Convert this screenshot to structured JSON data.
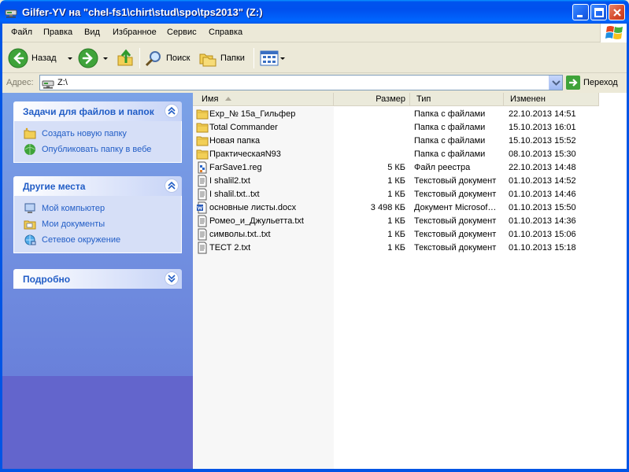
{
  "window": {
    "title": "Gilfer-YV  на \"chel-fs1\\chirt\\stud\\spo\\tps2013\" (Z:)"
  },
  "menu": [
    "Файл",
    "Правка",
    "Вид",
    "Избранное",
    "Сервис",
    "Справка"
  ],
  "toolbar": {
    "back_label": "Назад",
    "search_label": "Поиск",
    "folders_label": "Папки"
  },
  "address": {
    "label": "Адрес:",
    "value": "Z:\\",
    "go_label": "Переход"
  },
  "tasks_panel": {
    "title": "Задачи для файлов и папок",
    "items": [
      {
        "label": "Создать новую папку",
        "icon": "new-folder-icon"
      },
      {
        "label": "Опубликовать папку в вебе",
        "icon": "publish-web-icon"
      }
    ]
  },
  "places_panel": {
    "title": "Другие места",
    "items": [
      {
        "label": "Мой компьютер",
        "icon": "my-computer-icon"
      },
      {
        "label": "Мои документы",
        "icon": "my-documents-icon"
      },
      {
        "label": "Сетевое окружение",
        "icon": "network-icon"
      }
    ]
  },
  "details_panel": {
    "title": "Подробно"
  },
  "columns": {
    "name": "Имя",
    "size": "Размер",
    "type": "Тип",
    "modified": "Изменен"
  },
  "files": [
    {
      "name": "Exp_№ 15a_Гильфер",
      "size": "",
      "type": "Папка с файлами",
      "modified": "22.10.2013 14:51",
      "icon": "folder-icon"
    },
    {
      "name": "Total Commander",
      "size": "",
      "type": "Папка с файлами",
      "modified": "15.10.2013 16:01",
      "icon": "folder-icon"
    },
    {
      "name": "Новая папка",
      "size": "",
      "type": "Папка с файлами",
      "modified": "15.10.2013 15:52",
      "icon": "folder-icon"
    },
    {
      "name": "ПрактическаяN93",
      "size": "",
      "type": "Папка с файлами",
      "modified": "08.10.2013 15:30",
      "icon": "folder-icon"
    },
    {
      "name": "FarSave1.reg",
      "size": "5 КБ",
      "type": "Файл реестра",
      "modified": "22.10.2013 14:48",
      "icon": "registry-file-icon"
    },
    {
      "name": "I shalil2.txt",
      "size": "1 КБ",
      "type": "Текстовый документ",
      "modified": "01.10.2013 14:52",
      "icon": "text-file-icon"
    },
    {
      "name": "I shalil.txt..txt",
      "size": "1 КБ",
      "type": "Текстовый документ",
      "modified": "01.10.2013 14:46",
      "icon": "text-file-icon"
    },
    {
      "name": "основные листы.docx",
      "size": "3 498 КБ",
      "type": "Документ Microsof…",
      "modified": "01.10.2013 15:50",
      "icon": "word-document-icon"
    },
    {
      "name": "Ромео_и_Джульетта.txt",
      "size": "1 КБ",
      "type": "Текстовый документ",
      "modified": "01.10.2013 14:36",
      "icon": "text-file-icon"
    },
    {
      "name": "символы.txt..txt",
      "size": "1 КБ",
      "type": "Текстовый документ",
      "modified": "01.10.2013 15:06",
      "icon": "text-file-icon"
    },
    {
      "name": "ТЕСТ 2.txt",
      "size": "1 КБ",
      "type": "Текстовый документ",
      "modified": "01.10.2013 15:18",
      "icon": "text-file-icon"
    }
  ]
}
